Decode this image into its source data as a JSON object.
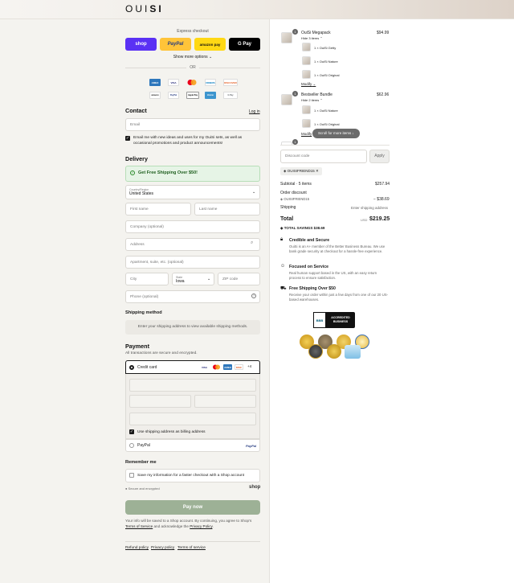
{
  "brand": {
    "logo_text_left": "OUI",
    "logo_text_right": "SI"
  },
  "express": {
    "label": "Express checkout",
    "buttons": [
      {
        "label": "shop",
        "color": "#5a31f4"
      },
      {
        "label": "PayPal",
        "color": "#ffc439"
      },
      {
        "label": "amazon pay",
        "color": "#ffd814"
      },
      {
        "label": "G Pay",
        "color": "#000000"
      }
    ],
    "more_label": "Show more options",
    "or_label": "OR"
  },
  "payment_logos_row1": [
    "AMEX",
    "VISA",
    "MC",
    "DINERS",
    "DISCOVER"
  ],
  "payment_logos_row2": [
    "amazon",
    "PayPal",
    "Apple Pay",
    "Venmo",
    "G Pay"
  ],
  "contact": {
    "title": "Contact",
    "login_label": "Log in",
    "email_placeholder": "Email",
    "newsletter_label": "Email me with new ideas and uses for my OuiSi sets, as well as occasional promotions and product announcements!"
  },
  "delivery": {
    "title": "Delivery",
    "banner": "Get Free Shipping Over $50!",
    "country_label": "Country/Region",
    "country_value": "United States",
    "first_name": "First name",
    "last_name": "Last name",
    "company": "Company (optional)",
    "address": "Address",
    "apartment": "Apartment, suite, etc. (optional)",
    "city": "City",
    "state_label": "State",
    "state_value": "Iowa",
    "zip": "ZIP code",
    "phone": "Phone (optional)"
  },
  "shipping_method": {
    "title": "Shipping method",
    "message": "Enter your shipping address to view available shipping methods."
  },
  "payment": {
    "title": "Payment",
    "subtitle": "All transactions are secure and encrypted.",
    "credit_card_label": "Credit card",
    "card_logos": [
      "VISA",
      "MC",
      "AMEX",
      "DISC"
    ],
    "more_cards": "+4",
    "billing_label": "Use shipping address as billing address",
    "paypal_label": "PayPal",
    "paypal_logo": "PayPal"
  },
  "remember": {
    "title": "Remember me",
    "label": "Save my information for a faster checkout with a Shop account",
    "secure_label": "Secure and encrypted",
    "shop_label": "shop"
  },
  "pay_button": "Pay now",
  "legal": {
    "text_before": "Your info will be saved to a Shop account. By continuing, you agree to Shop’s",
    "terms_link": "Terms of Service",
    "middle": "and acknowledge the",
    "privacy_link": "Privacy Policy",
    "end": "."
  },
  "footer_links": [
    "Refund policy",
    "Privacy policy",
    "Terms of service"
  ],
  "order": {
    "items": [
      {
        "qty": "1",
        "name": "OuiSi Megapack",
        "price": "$94.99",
        "toggle": "Hide 3 items",
        "children": [
          "1 × OuiSi Getty",
          "1 × OuiSi Nature",
          "1 × OuiSi Original"
        ],
        "modify": "Modify"
      },
      {
        "qty": "1",
        "name": "Bestseller Bundle",
        "price": "$62.96",
        "toggle": "Hide 2 items",
        "children": [
          "1 × OuiSi Nature",
          "1 × OuiSi Original"
        ],
        "modify": "Modify"
      }
    ],
    "third_qty": "1",
    "scroll_label": "Scroll for more items",
    "discount_placeholder": "Discount code",
    "apply_label": "Apply",
    "discount_tag": "OUISIFRIEND15",
    "subtotal_label": "Subtotal · 5 items",
    "subtotal_value": "$257.94",
    "order_discount_label": "Order discount",
    "discount_code": "OUISIFRIEND15",
    "discount_value": "− $38.69",
    "shipping_label": "Shipping",
    "shipping_value": "Enter shipping address",
    "total_label": "Total",
    "currency": "USD",
    "total_value": "$219.25",
    "savings_label": "TOTAL SAVINGS",
    "savings_value": "$38.69"
  },
  "trust": [
    {
      "title": "Credible and Secure",
      "text": "OuiSi is an A+ member of the Better Business Bureau. We use bank grade security at checkout for a hassle-free experience."
    },
    {
      "title": "Focused on Service",
      "text": "Real human support based in the US, with an easy return process to ensure satisfaction."
    },
    {
      "title": "Free Shipping Over $50",
      "text": "Receive your order within just a few days from one of our 20 US-based warehouses."
    }
  ],
  "bbb": {
    "mark": "BBB",
    "line1": "ACCREDITED",
    "line2": "BUSINESS"
  },
  "awards_count_note": "7 award seals"
}
